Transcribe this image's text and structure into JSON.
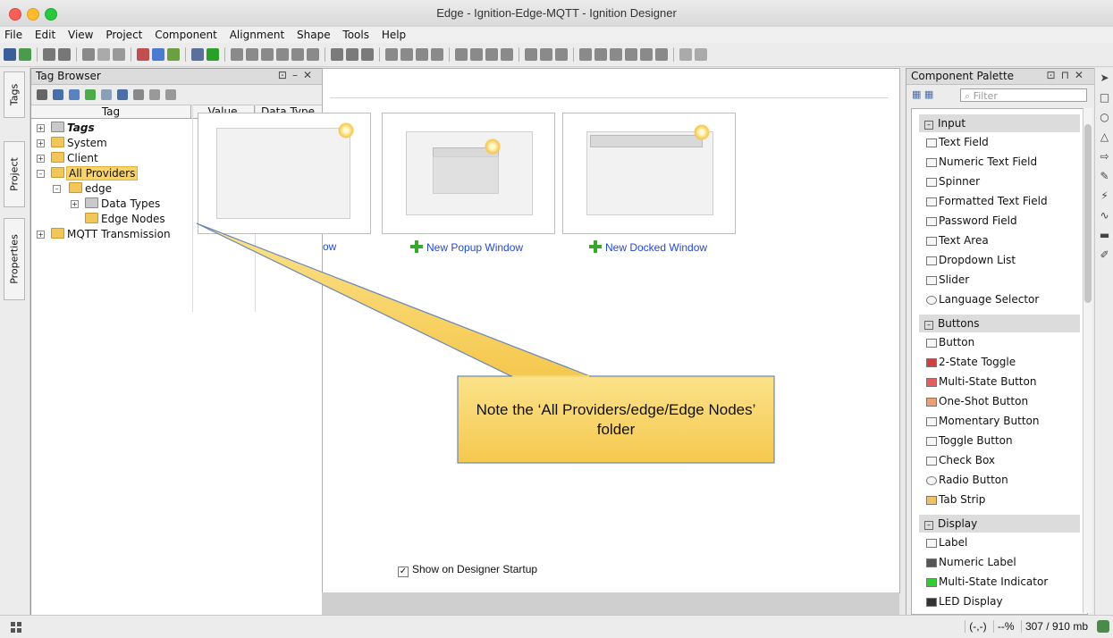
{
  "window": {
    "title": "Edge - Ignition-Edge-MQTT - Ignition Designer"
  },
  "menu": [
    "File",
    "Edit",
    "View",
    "Project",
    "Component",
    "Alignment",
    "Shape",
    "Tools",
    "Help"
  ],
  "left_tabs": [
    "Tags",
    "Project",
    "Properties"
  ],
  "tag_browser": {
    "title": "Tag Browser",
    "columns": [
      "Tag",
      "Value",
      "Data Type"
    ],
    "tree": [
      "Tags",
      "System",
      "Client",
      "All Providers",
      "edge",
      "Data Types",
      "Edge Nodes",
      "MQTT Transmission"
    ]
  },
  "center": {
    "links": [
      "ow",
      "New Popup Window",
      "New Docked Window"
    ],
    "startup_label": "Show on Designer Startup"
  },
  "palette": {
    "title": "Component Palette",
    "filter_placeholder": "Filter",
    "sections": [
      {
        "name": "Input",
        "items": [
          "Text Field",
          "Numeric Text Field",
          "Spinner",
          "Formatted Text Field",
          "Password Field",
          "Text Area",
          "Dropdown List",
          "Slider",
          "Language Selector"
        ]
      },
      {
        "name": "Buttons",
        "items": [
          "Button",
          "2-State Toggle",
          "Multi-State Button",
          "One-Shot Button",
          "Momentary Button",
          "Toggle Button",
          "Check Box",
          "Radio Button",
          "Tab Strip"
        ]
      },
      {
        "name": "Display",
        "items": [
          "Label",
          "Numeric Label",
          "Multi-State Indicator",
          "LED Display"
        ]
      }
    ]
  },
  "status": {
    "coords": "(-,-)",
    "zoom": "--%",
    "memory": "307 / 910 mb"
  },
  "callout": {
    "text": "Note the ‘All Providers/edge/Edge Nodes’ folder"
  },
  "colors": {
    "selection": "#f7d36c",
    "callout_fill": "#f7d36c",
    "link": "#2248d6"
  }
}
